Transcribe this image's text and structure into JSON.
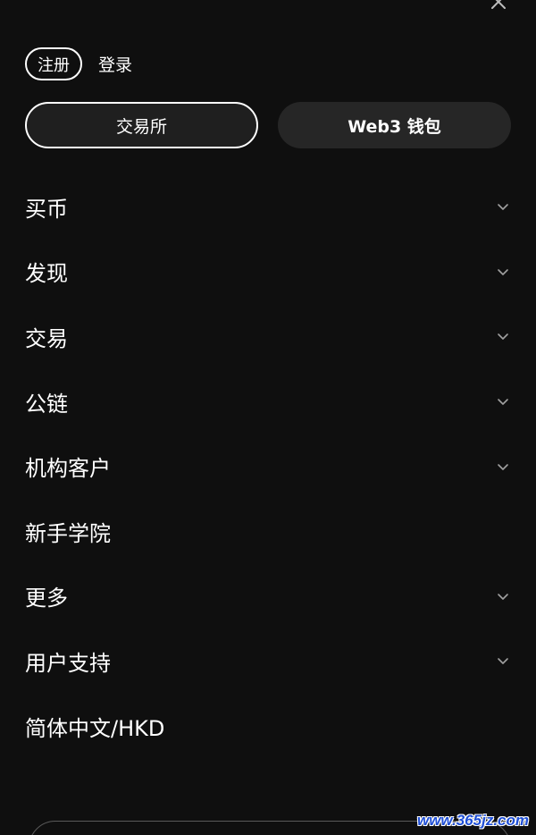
{
  "header": {
    "close_icon": "close-icon"
  },
  "auth": {
    "register_label": "注册",
    "login_label": "登录"
  },
  "segments": {
    "exchange_label": "交易所",
    "web3_label": "Web3 钱包",
    "selected": "交易所"
  },
  "menu": {
    "items": [
      {
        "label": "买币",
        "expandable": true
      },
      {
        "label": "发现",
        "expandable": true
      },
      {
        "label": "交易",
        "expandable": true
      },
      {
        "label": "公链",
        "expandable": true
      },
      {
        "label": "机构客户",
        "expandable": true
      },
      {
        "label": "新手学院",
        "expandable": false
      },
      {
        "label": "更多",
        "expandable": true
      },
      {
        "label": "用户支持",
        "expandable": true
      },
      {
        "label": "简体中文/HKD",
        "expandable": false
      }
    ]
  },
  "watermark": {
    "text": "www.365jz.com"
  },
  "colors": {
    "background": "#0f0f0f",
    "text": "#ffffff",
    "segment_inactive": "#262626",
    "chevron": "#a0a0a0"
  }
}
